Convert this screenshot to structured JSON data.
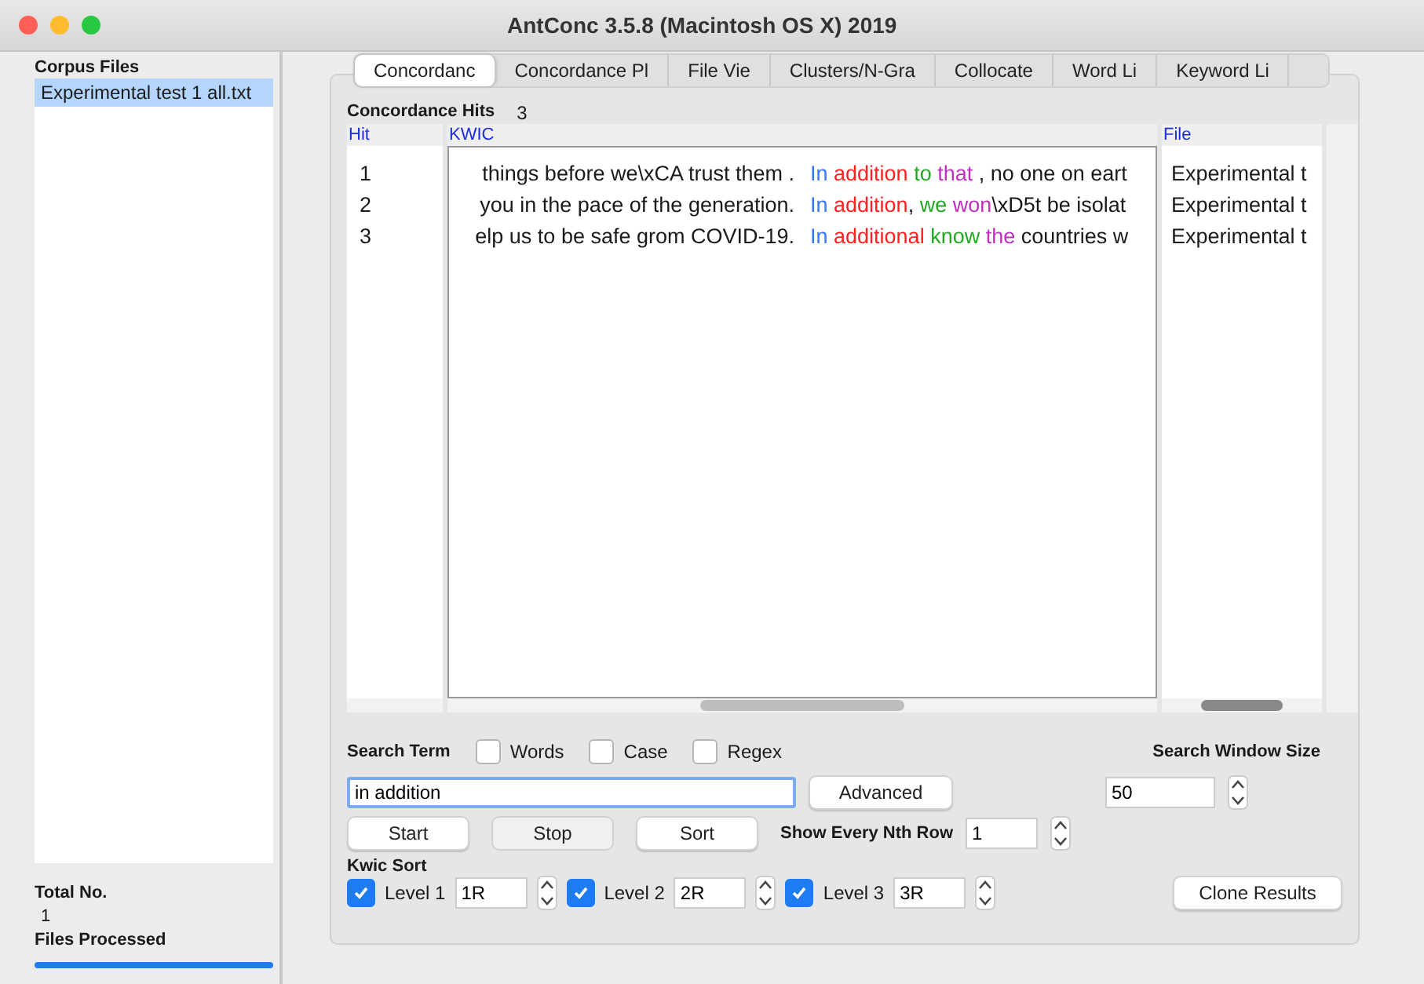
{
  "window": {
    "title": "AntConc 3.5.8 (Macintosh OS X) 2019"
  },
  "sidebar": {
    "heading": "Corpus Files",
    "files": [
      {
        "name": "Experimental test 1 all.txt",
        "selected": true
      }
    ],
    "total_label": "Total No.",
    "total_value": "1",
    "processed_label": "Files Processed",
    "progress": {
      "level": 1
    }
  },
  "tabs": [
    {
      "label": "Concordanc",
      "selected": true
    },
    {
      "label": "Concordance Pl",
      "selected": false
    },
    {
      "label": "File Vie",
      "selected": false
    },
    {
      "label": "Clusters/N-Gra",
      "selected": false
    },
    {
      "label": "Collocate",
      "selected": false
    },
    {
      "label": "Word Li",
      "selected": false
    },
    {
      "label": "Keyword Li",
      "selected": false
    }
  ],
  "hits": {
    "label": "Concordance Hits",
    "count": "3"
  },
  "table": {
    "columns": [
      "Hit",
      "KWIC",
      "File"
    ],
    "rows": [
      {
        "hit": "1",
        "left": "things before we\\xCA trust them .",
        "right": [
          {
            "text": "In",
            "color": "#3478f6"
          },
          {
            "text": " addition",
            "color": "#ff2020"
          },
          {
            "text": " to",
            "color": "#22aa22"
          },
          {
            "text": " that",
            "color": "#c030c0"
          },
          {
            "text": " , no one on eart"
          }
        ],
        "file": "Experimental t"
      },
      {
        "hit": "2",
        "left": "you in the pace of the generation.",
        "right": [
          {
            "text": "In",
            "color": "#3478f6"
          },
          {
            "text": " addition",
            "color": "#ff2020"
          },
          {
            "text": ", "
          },
          {
            "text": "we",
            "color": "#22aa22"
          },
          {
            "text": " won",
            "color": "#c030c0"
          },
          {
            "text": "\\xD5t be isolat"
          }
        ],
        "file": "Experimental t"
      },
      {
        "hit": "3",
        "left": "elp us to be safe grom COVID-19.",
        "right": [
          {
            "text": "In",
            "color": "#3478f6"
          },
          {
            "text": " additional",
            "color": "#ff2020"
          },
          {
            "text": " know",
            "color": "#22aa22"
          },
          {
            "text": " the",
            "color": "#c030c0"
          },
          {
            "text": " countries w"
          }
        ],
        "file": "Experimental t"
      }
    ]
  },
  "search": {
    "label": "Search Term",
    "options": [
      {
        "label": "Words",
        "checked": false
      },
      {
        "label": "Case",
        "checked": false
      },
      {
        "label": "Regex",
        "checked": false
      }
    ],
    "value": "in addition",
    "advanced": "Advanced",
    "window_label": "Search Window Size",
    "window_value": "50"
  },
  "buttons": [
    {
      "label": "Start",
      "disabled": false
    },
    {
      "label": "Stop",
      "disabled": true
    },
    {
      "label": "Sort",
      "disabled": false
    }
  ],
  "nth": {
    "label": "Show Every Nth Row",
    "value": "1"
  },
  "sort": {
    "label": "Kwic Sort",
    "levels": [
      {
        "label": "Level 1",
        "checked": true,
        "value": "1R"
      },
      {
        "label": "Level 2",
        "checked": true,
        "value": "2R"
      },
      {
        "label": "Level 3",
        "checked": true,
        "value": "3R"
      }
    ],
    "clone": "Clone Results"
  }
}
